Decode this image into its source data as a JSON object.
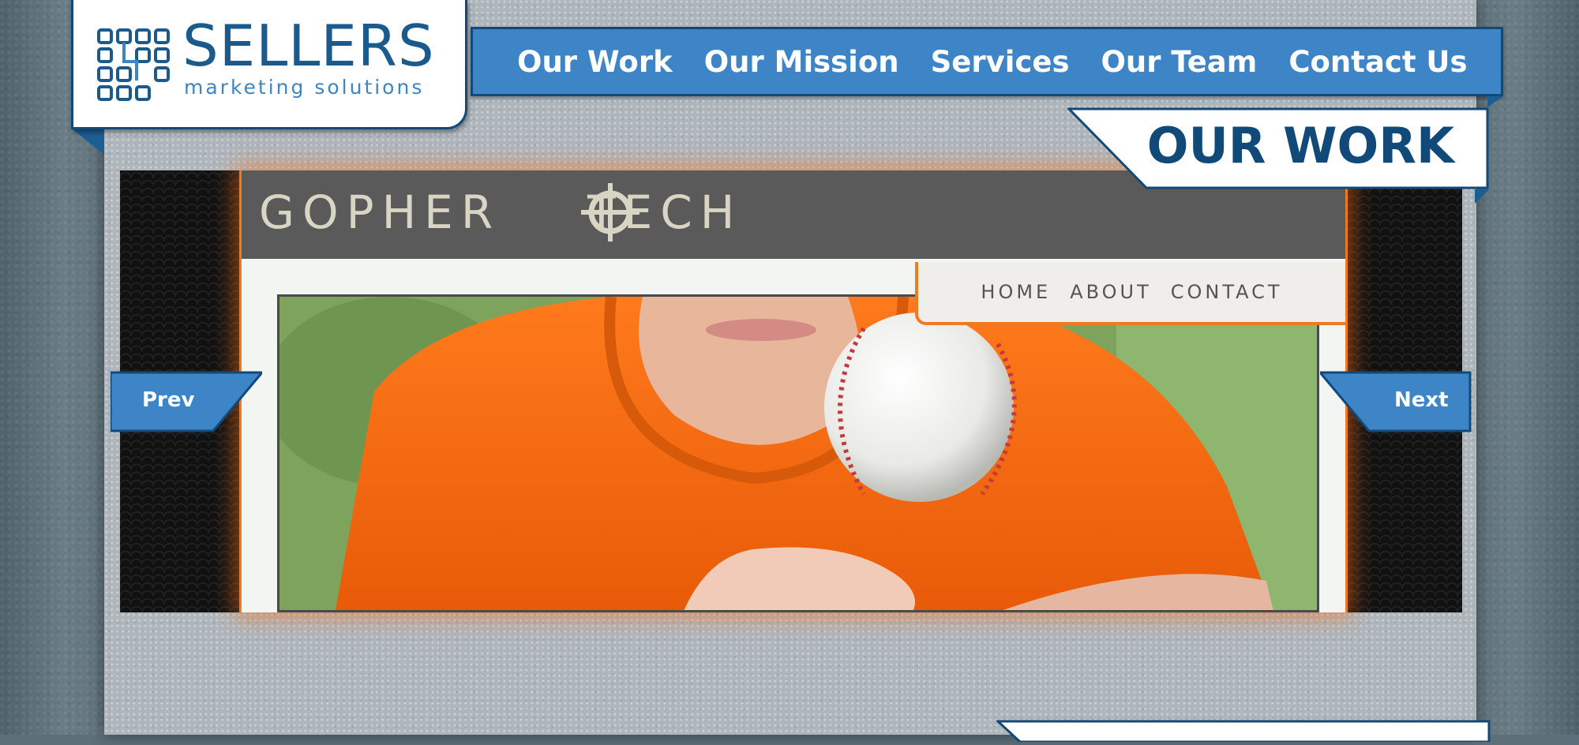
{
  "brand": {
    "name": "SELLERS",
    "tagline": "marketing solutions",
    "primary_color": "#3d85c6",
    "dark_color": "#114a78"
  },
  "nav": {
    "items": [
      {
        "label": "Our Work"
      },
      {
        "label": "Our Mission"
      },
      {
        "label": "Services"
      },
      {
        "label": "Our Team"
      },
      {
        "label": "Contact Us"
      }
    ]
  },
  "page": {
    "heading": "OUR WORK"
  },
  "slider": {
    "prev_label": "Prev",
    "next_label": "Next",
    "slide": {
      "site_logo_left": "GOPHER",
      "site_logo_right": "TECH",
      "site_nav": [
        "HOME",
        "ABOUT",
        "CONTACT"
      ],
      "accent_color": "#f07a22"
    }
  }
}
